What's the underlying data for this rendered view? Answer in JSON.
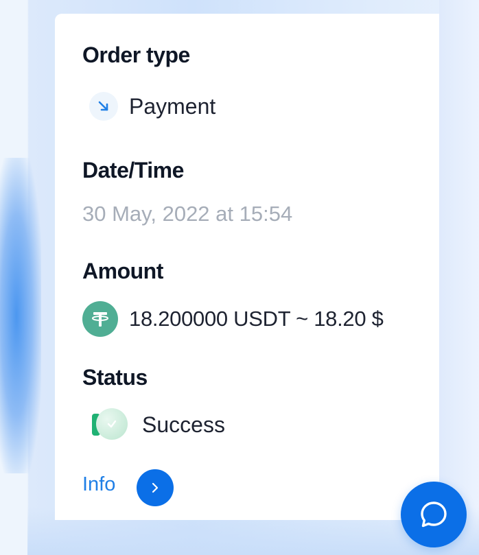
{
  "order_type": {
    "title": "Order type",
    "value": "Payment",
    "icon": "arrow-down-right-icon"
  },
  "date_time": {
    "title": "Date/Time",
    "value": "30 May, 2022 at 15:54"
  },
  "amount": {
    "title": "Amount",
    "value": "18.200000 USDT ~ 18.20 $",
    "icon": "tether-usdt-icon"
  },
  "status": {
    "title": "Status",
    "value": "Success",
    "icon": "success-check-icon"
  },
  "info": {
    "label": "Info",
    "icon": "chevron-right-icon"
  },
  "chat": {
    "icon": "chat-bubble-icon"
  },
  "colors": {
    "accent": "#0b6fe7",
    "success": "#1fb173",
    "usdt": "#50ae94",
    "muted_text": "#a6adb8"
  }
}
